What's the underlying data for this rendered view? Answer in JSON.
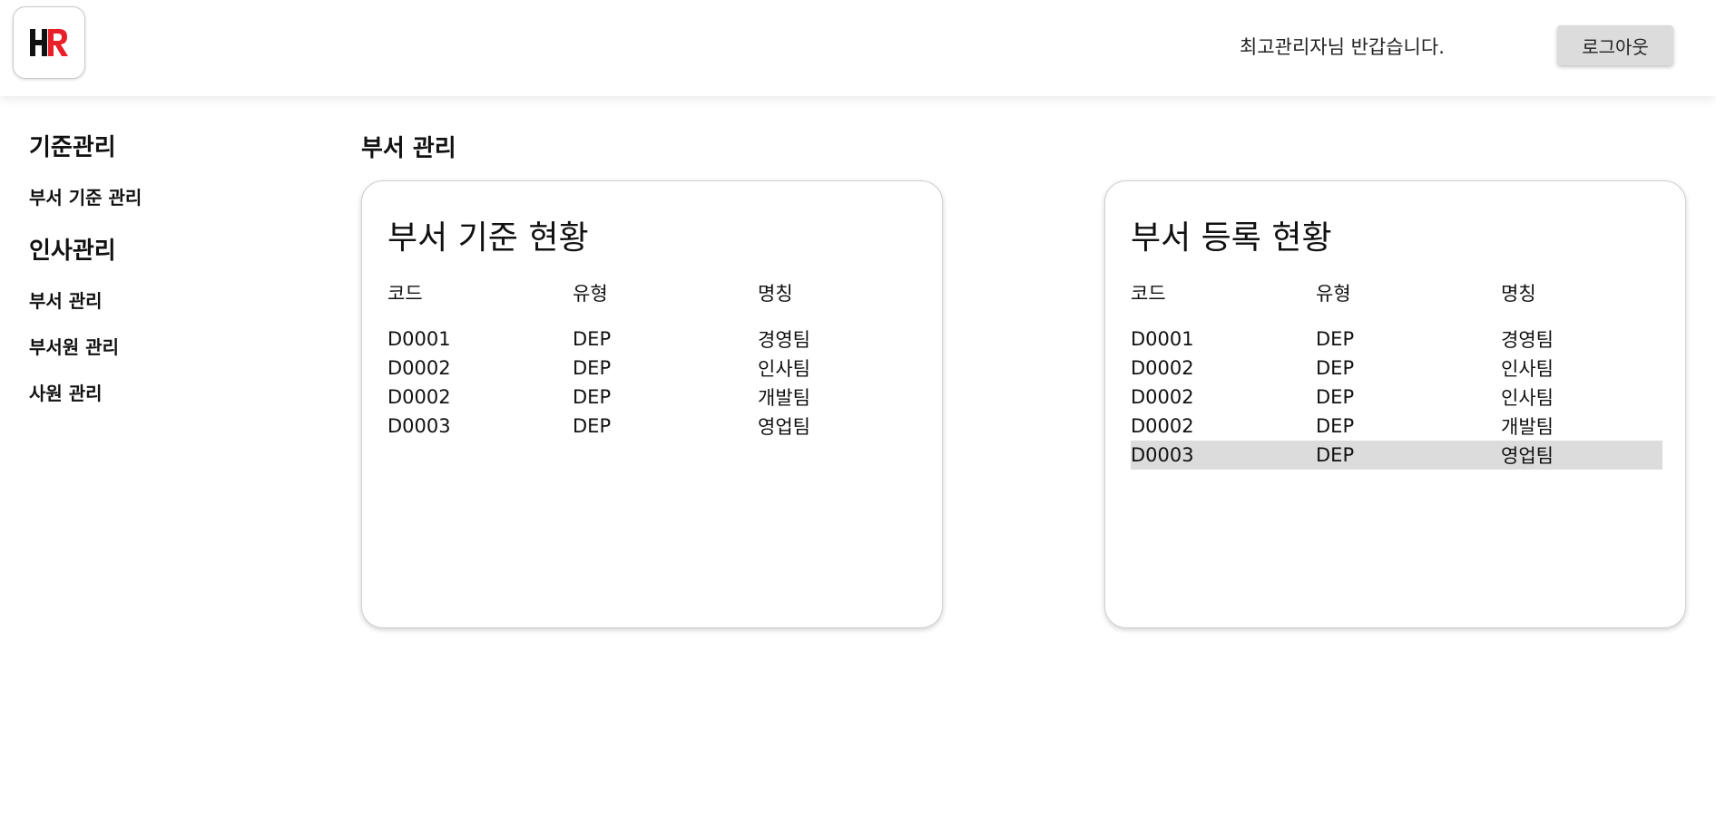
{
  "header": {
    "logo_text": "HR",
    "welcome": "최고관리자님 반갑습니다.",
    "logout_label": "로그아웃"
  },
  "sidebar": {
    "groups": [
      {
        "label": "기준관리",
        "items": [
          {
            "label": "부서 기준 관리"
          }
        ]
      },
      {
        "label": "인사관리",
        "items": [
          {
            "label": "부서 관리"
          },
          {
            "label": "부서원 관리"
          },
          {
            "label": "사원 관리"
          }
        ]
      }
    ]
  },
  "main": {
    "title": "부서 관리",
    "cards": [
      {
        "title": "부서 기준 현황",
        "columns": [
          "코드",
          "유형",
          "명칭"
        ],
        "rows": [
          [
            "D0001",
            "DEP",
            "경영팀"
          ],
          [
            "D0002",
            "DEP",
            "인사팀"
          ],
          [
            "D0002",
            "DEP",
            "개발팀"
          ],
          [
            "D0003",
            "DEP",
            "영업팀"
          ]
        ]
      },
      {
        "title": "부서 등록 현황",
        "columns": [
          "코드",
          "유형",
          "명칭"
        ],
        "rows": [
          [
            "D0001",
            "DEP",
            "경영팀"
          ],
          [
            "D0002",
            "DEP",
            "인사팀"
          ],
          [
            "D0002",
            "DEP",
            "인사팀"
          ],
          [
            "D0002",
            "DEP",
            "개발팀"
          ],
          [
            "D0003",
            "DEP",
            "영업팀"
          ]
        ],
        "selected_row": 4
      }
    ]
  },
  "colors": {
    "logo_h": "#111111",
    "logo_r": "#e8202a",
    "selected_row_bg": "#dcdcdc",
    "logout_bg": "#dcdcdc"
  }
}
